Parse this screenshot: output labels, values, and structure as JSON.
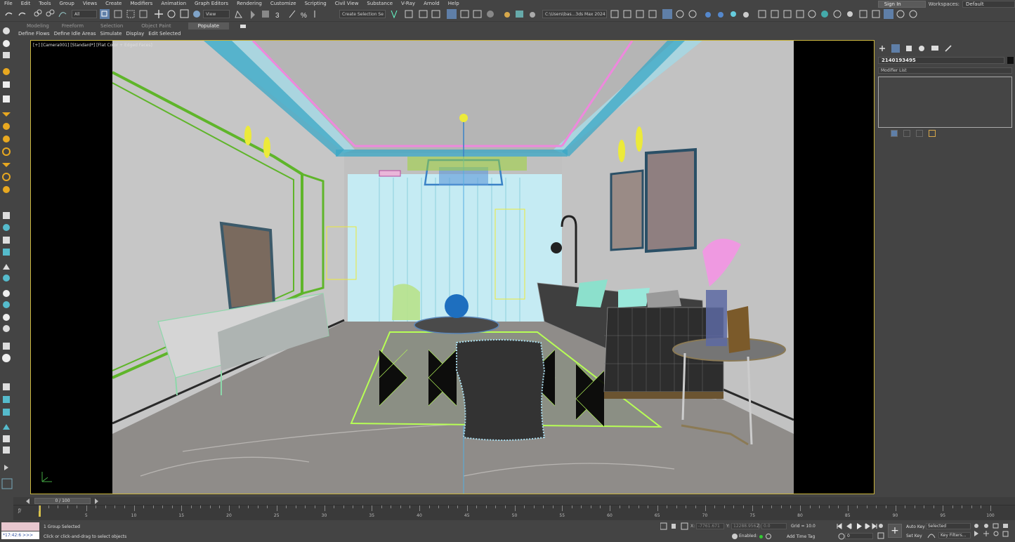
{
  "menu": [
    "File",
    "Edit",
    "Tools",
    "Group",
    "Views",
    "Create",
    "Modifiers",
    "Animation",
    "Graph Editors",
    "Rendering",
    "Customize",
    "Scripting",
    "Civil View",
    "Substance",
    "V-Ray",
    "Arnold",
    "Help"
  ],
  "signin": "Sign In",
  "workspaces_label": "Workspaces:",
  "workspace": "Default",
  "toolbar": {
    "filter": "All",
    "refcoord": "View",
    "selection_set": "Create Selection Se",
    "project_path": "C:\\Users\\bas...3ds Max 2024"
  },
  "ribbon": {
    "tabs": [
      "Modeling",
      "Freeform",
      "Selection",
      "Object Paint",
      "Populate"
    ],
    "active_tab": "Populate",
    "sub_items": [
      "Define Flows",
      "Define Idle Areas",
      "Simulate",
      "Display",
      "Edit Selected"
    ]
  },
  "viewport": {
    "label": "[+] [Camera001] [Standard*] [Flat Color + Edged Faces]"
  },
  "command_panel": {
    "object_name": "2140193495",
    "modifier_list": "Modifier List"
  },
  "timeslider": {
    "frame_label": "0 / 100",
    "current": 0,
    "total": 100
  },
  "timeline_ticks": [
    "0",
    "5",
    "10",
    "15",
    "20",
    "25",
    "30",
    "35",
    "40",
    "45",
    "50",
    "55",
    "60",
    "65",
    "70",
    "75",
    "80",
    "85",
    "90",
    "95",
    "100"
  ],
  "timeline_ticks2": [
    "5",
    "10",
    "15",
    "20",
    "25",
    "30",
    "35",
    "40",
    "45",
    "50",
    "55",
    "60",
    "65",
    "70",
    "75",
    "80",
    "85",
    "90",
    "95",
    "100"
  ],
  "status": {
    "selection": "1 Group Selected",
    "prompt": "Click or click-and-drag to select objects",
    "maxscript": "*17:42:6 >>>",
    "x_label": "X:",
    "x_value": "-7761.671",
    "y_label": "Y:",
    "y_value": "12288.956",
    "z_label": "Z:",
    "z_value": "0.0",
    "grid": "Grid = 10.0",
    "enabled_label": "Enabled:",
    "add_time_tag": "Add Time Tag",
    "auto_key": "Auto Key",
    "set_key": "Set Key",
    "key_mode": "Selected",
    "key_filters": "Key Filters...",
    "frame": "0"
  },
  "colors": {
    "viewport_border": "#c9b43c",
    "selection_blue": "#5f7fa8",
    "ceiling_pink": "#ee88dd",
    "ceiling_cyan": "#3aa7c6",
    "wall_green": "#5fb52a",
    "rug_green": "#b7ff55",
    "light_yellow": "#ecea3a"
  }
}
